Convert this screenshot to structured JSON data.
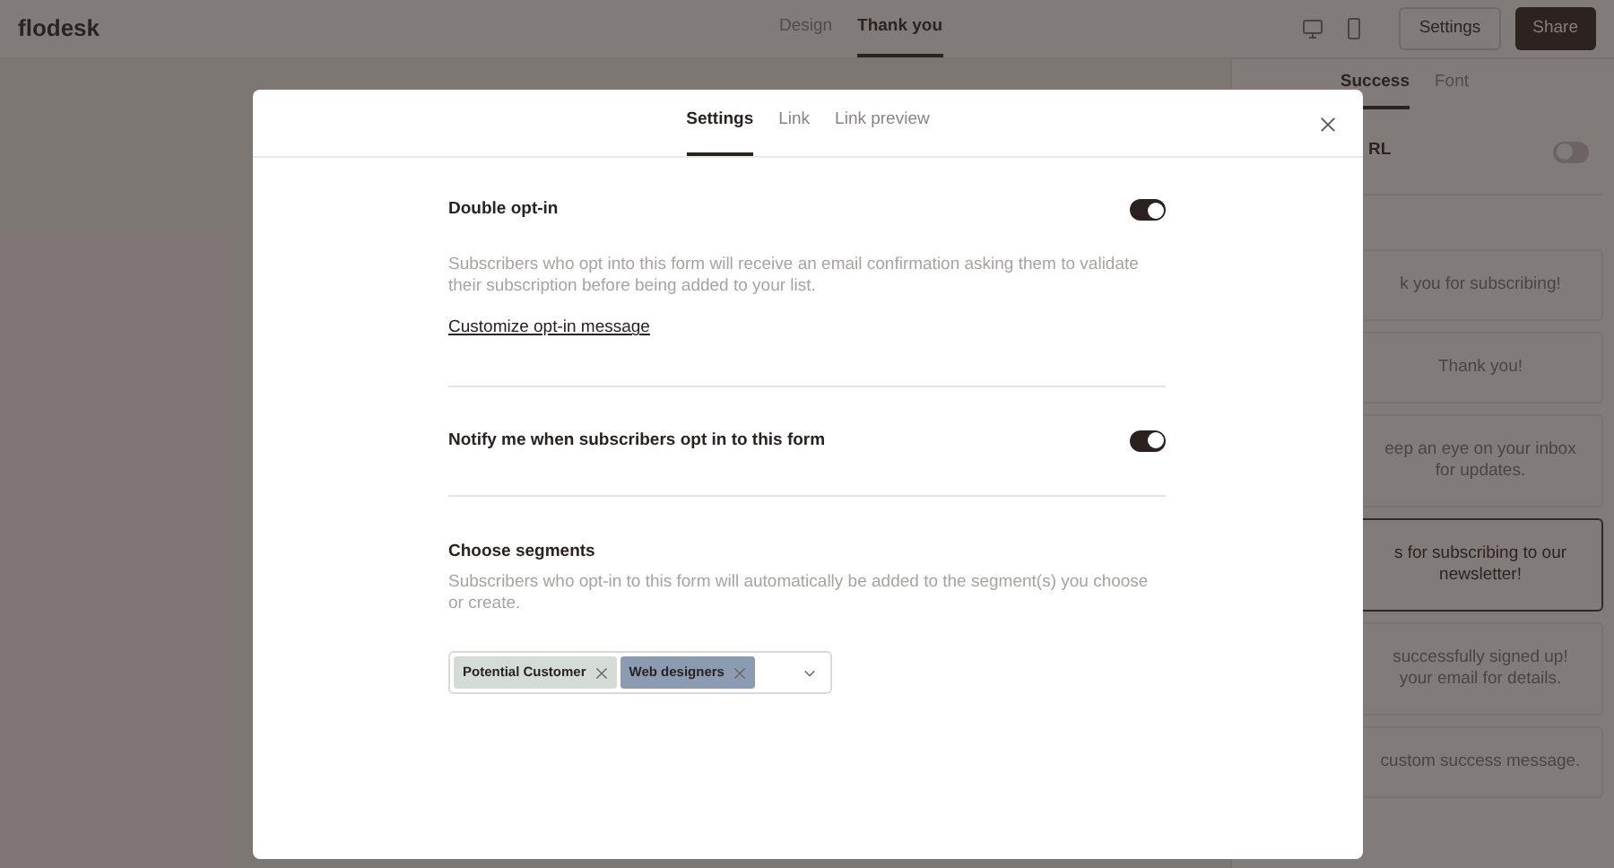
{
  "app": {
    "logo": "flodesk"
  },
  "top_tabs": [
    {
      "label": "Design",
      "selected": false
    },
    {
      "label": "Thank you",
      "selected": true
    }
  ],
  "buttons": {
    "settings": "Settings",
    "share": "Share"
  },
  "panel": {
    "tabs": [
      {
        "label": "Success",
        "selected": true
      },
      {
        "label": "Font",
        "selected": false
      }
    ],
    "url_toggle": {
      "label": "RL",
      "on": false
    },
    "messages": [
      {
        "lines": [
          "k you for subscribing!"
        ],
        "selected": false
      },
      {
        "lines": [
          "Thank you!"
        ],
        "selected": false
      },
      {
        "lines": [
          "eep an eye on your inbox",
          "for updates."
        ],
        "selected": false
      },
      {
        "lines": [
          "s for subscribing to our",
          "newsletter!"
        ],
        "selected": true
      },
      {
        "lines": [
          "successfully signed up!",
          "your email for details."
        ],
        "selected": false
      },
      {
        "lines": [
          "custom success message."
        ],
        "selected": false
      }
    ]
  },
  "modal": {
    "tabs": [
      {
        "label": "Settings",
        "selected": true
      },
      {
        "label": "Link",
        "selected": false
      },
      {
        "label": "Link preview",
        "selected": false
      }
    ],
    "sections": [
      {
        "kind": "toggle",
        "title": "Double opt-in",
        "on": true,
        "description": "Subscribers who opt into this form will receive an email confirmation asking them to validate their subscription before being added to your list.",
        "link": "Customize opt-in message"
      },
      {
        "kind": "toggle",
        "title": "Notify me when subscribers opt in to this form",
        "on": true
      },
      {
        "kind": "segments",
        "title": "Choose segments",
        "description": "Subscribers who opt-in to this form will automatically be added to the segment(s) you choose or create.",
        "tags": [
          {
            "label": "Potential Customer",
            "color": "#d3dcd6"
          },
          {
            "label": "Web designers",
            "color": "#8b9cb2"
          }
        ]
      }
    ]
  }
}
